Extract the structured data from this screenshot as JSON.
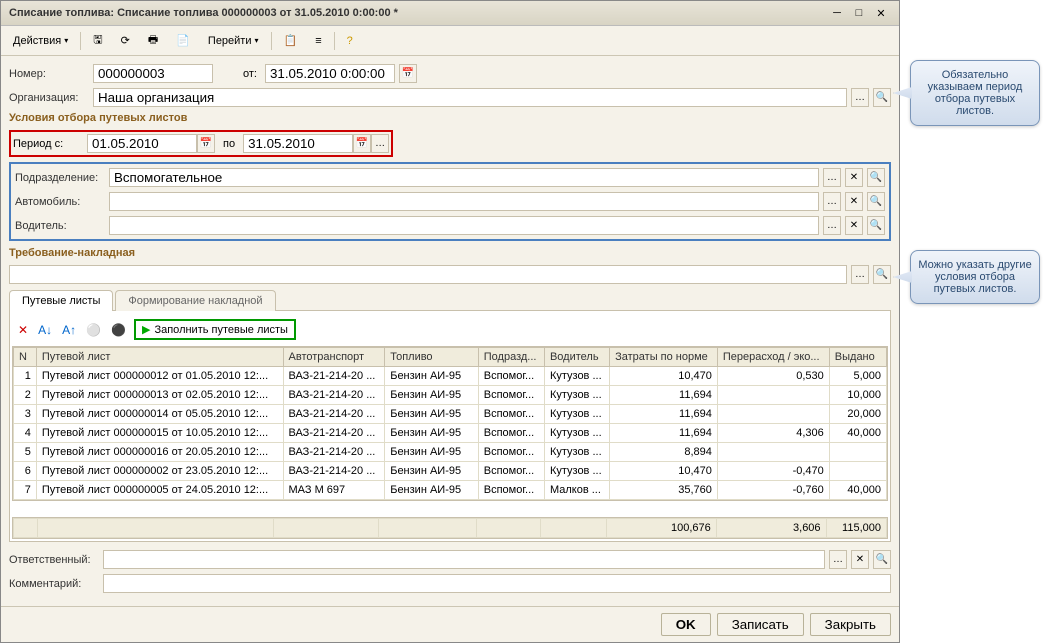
{
  "titlebar": {
    "title": "Списание топлива: Списание топлива 000000003 от 31.05.2010 0:00:00 *"
  },
  "toolbar": {
    "actions": "Действия",
    "goto": "Перейти"
  },
  "form": {
    "number_label": "Номер:",
    "number": "000000003",
    "from_label": "от:",
    "from": "31.05.2010 0:00:00",
    "org_label": "Организация:",
    "org": "Наша организация"
  },
  "section1": {
    "title": "Условия отбора путевых листов"
  },
  "period": {
    "label": "Период с:",
    "from": "01.05.2010",
    "to_label": "по",
    "to": "31.05.2010"
  },
  "filters": {
    "subdiv_label": "Подразделение:",
    "subdiv": "Вспомогательное",
    "auto_label": "Автомобиль:",
    "auto": "",
    "driver_label": "Водитель:",
    "driver": ""
  },
  "section2": {
    "title": "Требование-накладная"
  },
  "tabs": {
    "tab1": "Путевые листы",
    "tab2": "Формирование накладной"
  },
  "fill_btn": "Заполнить путевые листы",
  "columns": {
    "n": "N",
    "sheet": "Путевой лист",
    "auto": "Автотранспорт",
    "fuel": "Топливо",
    "subdiv": "Подразд...",
    "driver": "Водитель",
    "norm": "Затраты по норме",
    "over": "Перерасход / эко...",
    "issued": "Выдано"
  },
  "rows": [
    {
      "n": "1",
      "sheet": "Путевой лист 000000012 от 01.05.2010 12:...",
      "auto": "ВАЗ-21-214-20 ...",
      "fuel": "Бензин АИ-95",
      "subdiv": "Вспомог...",
      "driver": "Кутузов ...",
      "norm": "10,470",
      "over": "0,530",
      "issued": "5,000"
    },
    {
      "n": "2",
      "sheet": "Путевой лист 000000013 от 02.05.2010 12:...",
      "auto": "ВАЗ-21-214-20 ...",
      "fuel": "Бензин АИ-95",
      "subdiv": "Вспомог...",
      "driver": "Кутузов ...",
      "norm": "11,694",
      "over": "",
      "issued": "10,000"
    },
    {
      "n": "3",
      "sheet": "Путевой лист 000000014 от 05.05.2010 12:...",
      "auto": "ВАЗ-21-214-20 ...",
      "fuel": "Бензин АИ-95",
      "subdiv": "Вспомог...",
      "driver": "Кутузов ...",
      "norm": "11,694",
      "over": "",
      "issued": "20,000"
    },
    {
      "n": "4",
      "sheet": "Путевой лист 000000015 от 10.05.2010 12:...",
      "auto": "ВАЗ-21-214-20 ...",
      "fuel": "Бензин АИ-95",
      "subdiv": "Вспомог...",
      "driver": "Кутузов ...",
      "norm": "11,694",
      "over": "4,306",
      "issued": "40,000"
    },
    {
      "n": "5",
      "sheet": "Путевой лист 000000016 от 20.05.2010 12:...",
      "auto": "ВАЗ-21-214-20 ...",
      "fuel": "Бензин АИ-95",
      "subdiv": "Вспомог...",
      "driver": "Кутузов ...",
      "norm": "8,894",
      "over": "",
      "issued": ""
    },
    {
      "n": "6",
      "sheet": "Путевой лист 000000002 от 23.05.2010 12:...",
      "auto": "ВАЗ-21-214-20 ...",
      "fuel": "Бензин АИ-95",
      "subdiv": "Вспомог...",
      "driver": "Кутузов ...",
      "norm": "10,470",
      "over": "-0,470",
      "issued": ""
    },
    {
      "n": "7",
      "sheet": "Путевой лист 000000005 от 24.05.2010 12:...",
      "auto": "МАЗ М 697",
      "fuel": "Бензин АИ-95",
      "subdiv": "Вспомог...",
      "driver": "Малков ...",
      "norm": "35,760",
      "over": "-0,760",
      "issued": "40,000"
    }
  ],
  "totals": {
    "norm": "100,676",
    "over": "3,606",
    "issued": "115,000"
  },
  "bottom": {
    "resp_label": "Ответственный:",
    "comment_label": "Комментарий:"
  },
  "footer": {
    "ok": "OK",
    "save": "Записать",
    "close": "Закрыть"
  },
  "callouts": {
    "c1": "Обязательно указываем период отбора путевых листов.",
    "c2": "Можно указать другие условия отбора путевых листов."
  }
}
